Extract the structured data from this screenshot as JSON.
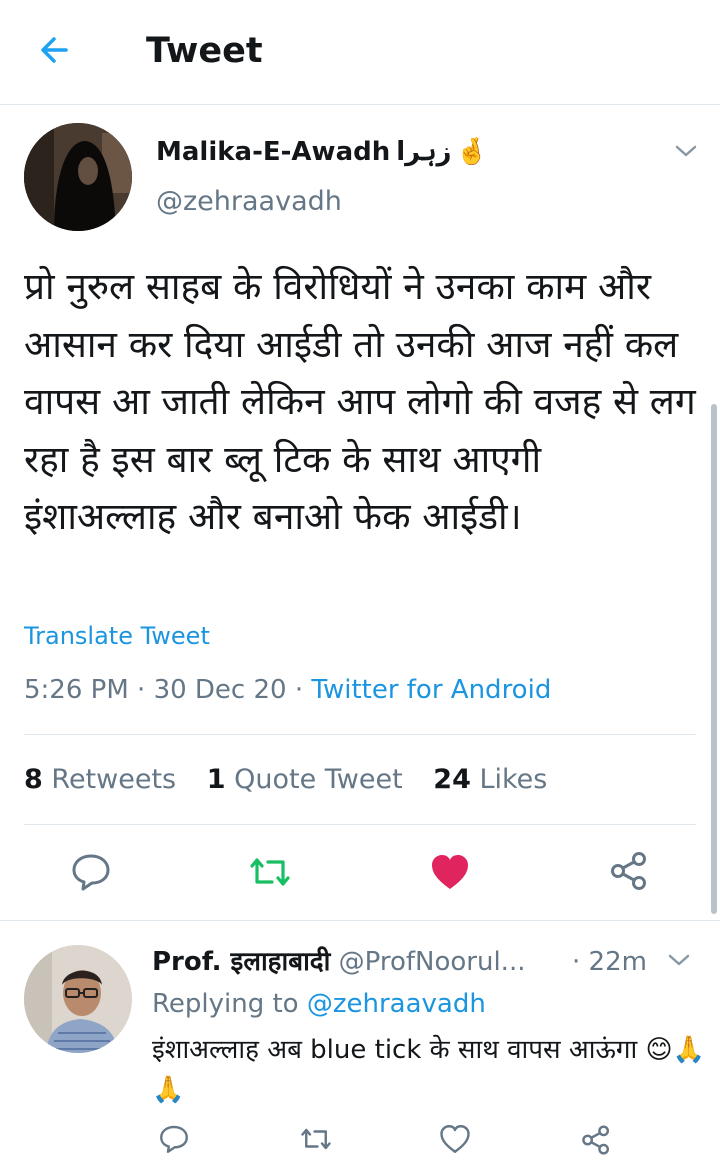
{
  "header": {
    "title": "Tweet",
    "back_icon": "arrow-left-icon"
  },
  "tweet": {
    "author_name": "Malika-E-Awadh",
    "author_name_urdu": "زہرا",
    "author_emoji": "🤞",
    "author_handle": "@zehraavadh",
    "text": "प्रो नुरुल साहब के विरोधियों ने उनका काम और आसान कर दिया आईडी तो उनकी आज नहीं कल वापस आ जाती लेकिन आप लोगो की वजह से लग रहा है इस बार ब्लू टिक के साथ आएगी इंशाअल्लाह और बनाओ फेक आईडी।",
    "translate_label": "Translate Tweet",
    "time": "5:26 PM",
    "date": "30 Dec 20",
    "source": "Twitter for Android",
    "stats": {
      "retweets_count": "8",
      "retweets_label": "Retweets",
      "quotes_count": "1",
      "quotes_label": "Quote Tweet",
      "likes_count": "24",
      "likes_label": "Likes"
    },
    "liked": true
  },
  "reply": {
    "name": "Prof. इलाहाबादी",
    "handle": "@ProfNoorul...",
    "time": "22m",
    "replying_prefix": "Replying to",
    "replying_to": "@zehraavadh",
    "text": "इंशाअल्लाह अब  blue tick  के साथ वापस आऊंगा 😊🙏🙏"
  },
  "colors": {
    "link": "#1b95e0",
    "like": "#e0245e",
    "retweet": "#17bf63",
    "muted": "#657786"
  }
}
